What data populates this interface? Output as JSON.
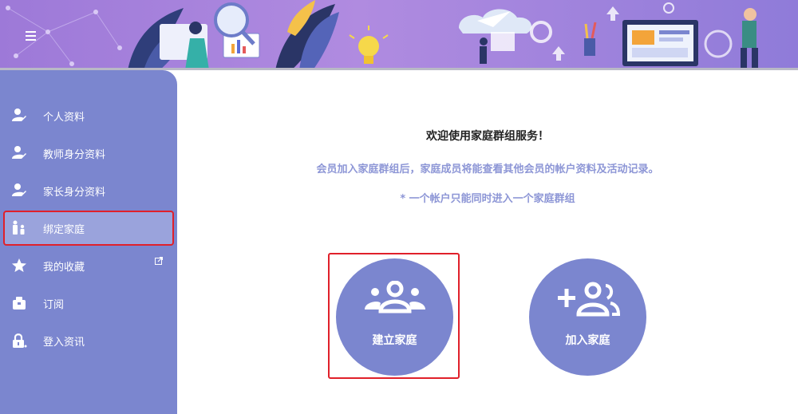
{
  "header": {
    "menu_icon": "hamburger-menu-icon"
  },
  "sidebar": {
    "items": [
      {
        "label": "个人资料",
        "icon": "user-edit-icon"
      },
      {
        "label": "教师身分资料",
        "icon": "user-edit-icon"
      },
      {
        "label": "家长身分资料",
        "icon": "user-edit-icon"
      },
      {
        "label": "绑定家庭",
        "icon": "family-icon",
        "active": true
      },
      {
        "label": "我的收藏",
        "icon": "star-icon",
        "external": "external-link-icon"
      },
      {
        "label": "订阅",
        "icon": "subscribe-box-icon"
      },
      {
        "label": "登入资讯",
        "icon": "lock-icon"
      }
    ]
  },
  "main": {
    "title": "欢迎使用家庭群组服务！",
    "description": "会员加入家庭群组后，家庭成员将能查看其他会员的帐户资料及活动记录。",
    "note": "* 一个帐户只能同时进入一个家庭群组",
    "create_label": "建立家庭",
    "join_label": "加入家庭"
  },
  "colors": {
    "accent": "#7b86cf",
    "text_accent": "#8d96d6",
    "highlight": "#e0202a"
  }
}
